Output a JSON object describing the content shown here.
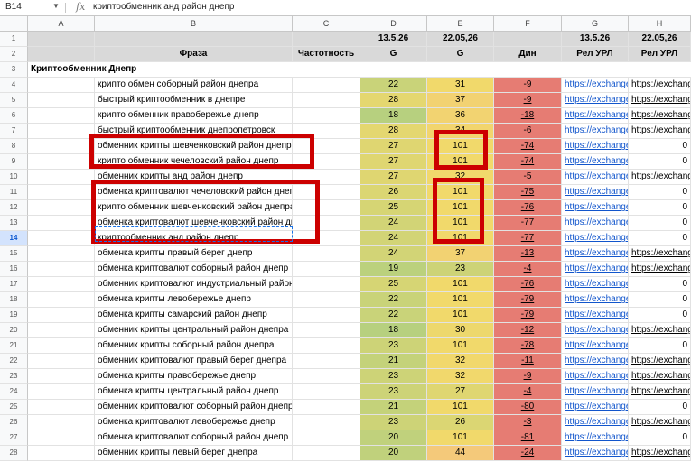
{
  "formula_bar": {
    "cell_ref": "B14",
    "fx": "fx",
    "formula": "криптообменник анд район днепр"
  },
  "columns": [
    "A",
    "B",
    "C",
    "D",
    "E",
    "F",
    "G",
    "H"
  ],
  "header_row1": {
    "d": "13.5.26",
    "e": "22.05,26",
    "g": "13.5.26",
    "h": "22.05,26"
  },
  "header_row2": {
    "b": "Фраза",
    "c": "Частотность",
    "d": "G",
    "e": "G",
    "f": "Дин",
    "g": "Рел УРЛ",
    "h": "Рел УРЛ"
  },
  "section_title": "Криптообменник Днепр",
  "rows": [
    {
      "n": "4",
      "phrase": "крипто обмен соборный район днепра",
      "d": "22",
      "e": "31",
      "f": "-9",
      "g": "https://exchange",
      "h": "https://exchang"
    },
    {
      "n": "5",
      "phrase": "быстрый криптообменник в днепре",
      "d": "28",
      "e": "37",
      "f": "-9",
      "g": "https://exchange",
      "h": "https://exchang"
    },
    {
      "n": "6",
      "phrase": "крипто обменник правобережье днепр",
      "d": "18",
      "e": "36",
      "f": "-18",
      "g": "https://exchange",
      "h": "https://exchang"
    },
    {
      "n": "7",
      "phrase": "быстрый криптообменник днепропетровск",
      "d": "28",
      "e": "34",
      "f": "-6",
      "g": "https://exchange",
      "h": "https://exchang"
    },
    {
      "n": "8",
      "phrase": "обменник крипты шевченковский район днепра",
      "d": "27",
      "e": "101",
      "f": "-74",
      "g": "https://exchange",
      "h": "0"
    },
    {
      "n": "9",
      "phrase": "крипто обменник чечеловский район днепр",
      "d": "27",
      "e": "101",
      "f": "-74",
      "g": "https://exchange",
      "h": "0"
    },
    {
      "n": "10",
      "phrase": "обменник крипты анд район днепр",
      "d": "27",
      "e": "32",
      "f": "-5",
      "g": "https://exchange",
      "h": "https://exchang"
    },
    {
      "n": "11",
      "phrase": "обменка криптовалют чечеловский район днепр",
      "d": "26",
      "e": "101",
      "f": "-75",
      "g": "https://exchange",
      "h": "0"
    },
    {
      "n": "12",
      "phrase": "крипто обменник шевченковский район днепра",
      "d": "25",
      "e": "101",
      "f": "-76",
      "g": "https://exchange",
      "h": "0"
    },
    {
      "n": "13",
      "phrase": "обменка криптовалют шевченковский район днепр",
      "d": "24",
      "e": "101",
      "f": "-77",
      "g": "https://exchange",
      "h": "0"
    },
    {
      "n": "14",
      "phrase": "криптообменник анд район днепр",
      "d": "24",
      "e": "101",
      "f": "-77",
      "g": "https://exchange",
      "h": "0"
    },
    {
      "n": "15",
      "phrase": "обменка крипты правый берег днепр",
      "d": "24",
      "e": "37",
      "f": "-13",
      "g": "https://exchange",
      "h": "https://exchang"
    },
    {
      "n": "16",
      "phrase": "обменка криптовалют соборный район днепр",
      "d": "19",
      "e": "23",
      "f": "-4",
      "g": "https://exchange",
      "h": "https://exchang"
    },
    {
      "n": "17",
      "phrase": "обменник криптовалют индустриальный район днепра",
      "d": "25",
      "e": "101",
      "f": "-76",
      "g": "https://exchange",
      "h": "0"
    },
    {
      "n": "18",
      "phrase": "обменка крипты левобережье днепр",
      "d": "22",
      "e": "101",
      "f": "-79",
      "g": "https://exchange",
      "h": "0"
    },
    {
      "n": "19",
      "phrase": "обменка крипты самарский район днепр",
      "d": "22",
      "e": "101",
      "f": "-79",
      "g": "https://exchange",
      "h": "0"
    },
    {
      "n": "20",
      "phrase": "обменник крипты центральный район днепра",
      "d": "18",
      "e": "30",
      "f": "-12",
      "g": "https://exchange",
      "h": "https://exchang"
    },
    {
      "n": "21",
      "phrase": "обменник крипты соборный район днепра",
      "d": "23",
      "e": "101",
      "f": "-78",
      "g": "https://exchange",
      "h": "0"
    },
    {
      "n": "22",
      "phrase": "обменник криптовалют правый берег днепра",
      "d": "21",
      "e": "32",
      "f": "-11",
      "g": "https://exchange",
      "h": "https://exchang"
    },
    {
      "n": "23",
      "phrase": "обменка крипты правобережье днепр",
      "d": "23",
      "e": "32",
      "f": "-9",
      "g": "https://exchange",
      "h": "https://exchang"
    },
    {
      "n": "24",
      "phrase": "обменка крипты центральный район днепр",
      "d": "23",
      "e": "27",
      "f": "-4",
      "g": "https://exchange",
      "h": "https://exchang"
    },
    {
      "n": "25",
      "phrase": "обменник криптовалют соборный район днепр",
      "d": "21",
      "e": "101",
      "f": "-80",
      "g": "https://exchange",
      "h": "0"
    },
    {
      "n": "26",
      "phrase": "обменка криптовалют левобережье днепр",
      "d": "23",
      "e": "26",
      "f": "-3",
      "g": "https://exchange",
      "h": "https://exchang"
    },
    {
      "n": "27",
      "phrase": "обменка криптовалют соборный район днепр",
      "d": "20",
      "e": "101",
      "f": "-81",
      "g": "https://exchange",
      "h": "0"
    },
    {
      "n": "28",
      "phrase": "обменник крипты левый берег днепра",
      "d": "20",
      "e": "44",
      "f": "-24",
      "g": "https://exchange",
      "h": "https://exchang"
    }
  ],
  "colors": {
    "header_band": "#d9d9d9",
    "dyn_red": "#e67c73",
    "annotation_red": "#cc0000",
    "link": "#1155cc"
  }
}
